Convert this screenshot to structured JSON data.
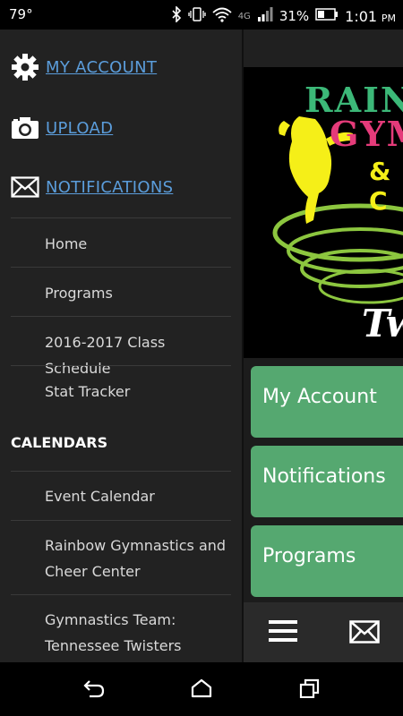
{
  "status_bar": {
    "temperature": "79°",
    "battery_percent": "31%",
    "time": "1:01",
    "ampm": "PM",
    "network": "4G"
  },
  "drawer": {
    "top_links": [
      {
        "label": "MY ACCOUNT",
        "icon": "gear-icon"
      },
      {
        "label": "UPLOAD",
        "icon": "camera-icon"
      },
      {
        "label": "NOTIFICATIONS",
        "icon": "envelope-icon"
      }
    ],
    "nav_items": [
      "Home",
      "Programs",
      "2016-2017 Class Schedule",
      "Stat Tracker"
    ],
    "calendars_title": "CALENDARS",
    "calendar_items": [
      "Event Calendar",
      "Rainbow Gymnastics and Cheer Center",
      "Gymnastics Team: Tennessee Twisters"
    ]
  },
  "main": {
    "tiles": [
      "My Account",
      "Notifications",
      "Programs"
    ],
    "logo_text": {
      "line1": "RAIN",
      "line2": "GYM",
      "line3": "& C",
      "line4": "Tw"
    },
    "tile_color": "#55a870"
  },
  "colors": {
    "link": "#5b9ddb",
    "drawer_bg": "#222222"
  }
}
